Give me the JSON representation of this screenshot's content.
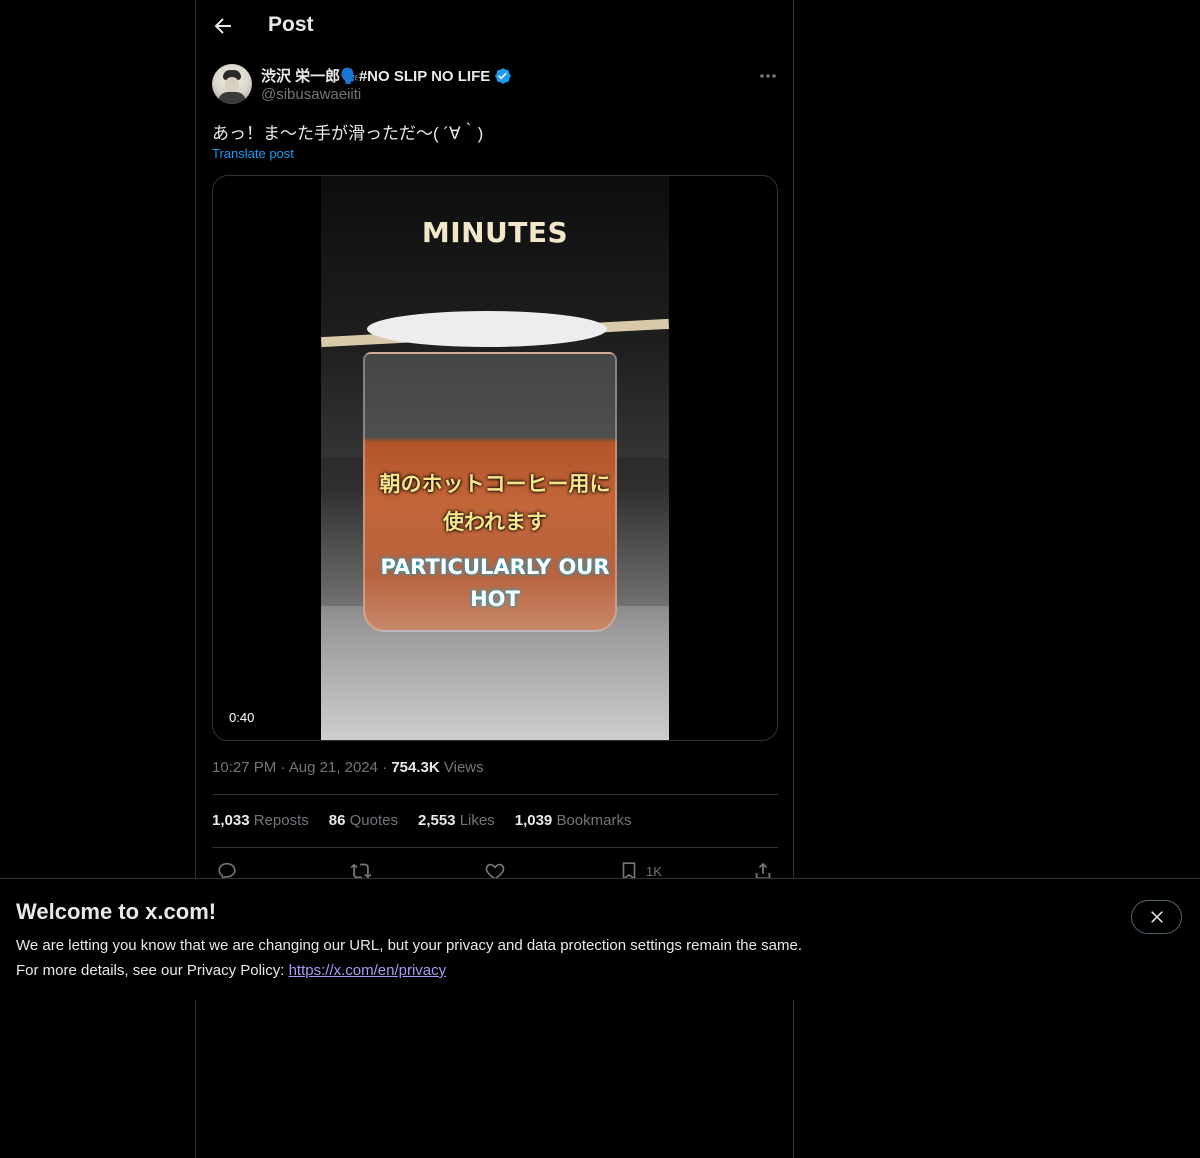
{
  "header": {
    "title": "Post"
  },
  "author": {
    "display_name": "渋沢 栄一郎🗣️#NO SLIP NO LIFE",
    "handle": "@sibusawaeiiti",
    "verified_color": "#1d9bf0"
  },
  "post": {
    "text": "あっ！ま〜た手が滑っただ〜( ´∀｀)",
    "translate_label": "Translate post"
  },
  "media": {
    "overlay_title": "MINUTES",
    "jp_caption_line1": "朝のホットコーヒー用に",
    "jp_caption_line2": "使われます",
    "en_caption_line1": "PARTICULARLY OUR",
    "en_caption_line2": "HOT",
    "duration": "0:40"
  },
  "meta": {
    "time": "10:27 PM",
    "date": "Aug 21, 2024",
    "views_count": "754.3K",
    "views_label": "Views"
  },
  "stats": {
    "reposts_count": "1,033",
    "reposts_label": "Reposts",
    "quotes_count": "86",
    "quotes_label": "Quotes",
    "likes_count": "2,553",
    "likes_label": "Likes",
    "bookmarks_count": "1,039",
    "bookmarks_label": "Bookmarks"
  },
  "actions": {
    "bookmark_count": "1K"
  },
  "banner": {
    "title": "Welcome to x.com!",
    "line1": "We are letting you know that we are changing our URL, but your privacy and data protection settings remain the same.",
    "line2_prefix": "For more details, see our Privacy Policy: ",
    "link_text": "https://x.com/en/privacy"
  },
  "colors": {
    "accent": "#1d9bf0",
    "link_in_banner": "#a99bf4",
    "muted_text": "#71767b"
  }
}
